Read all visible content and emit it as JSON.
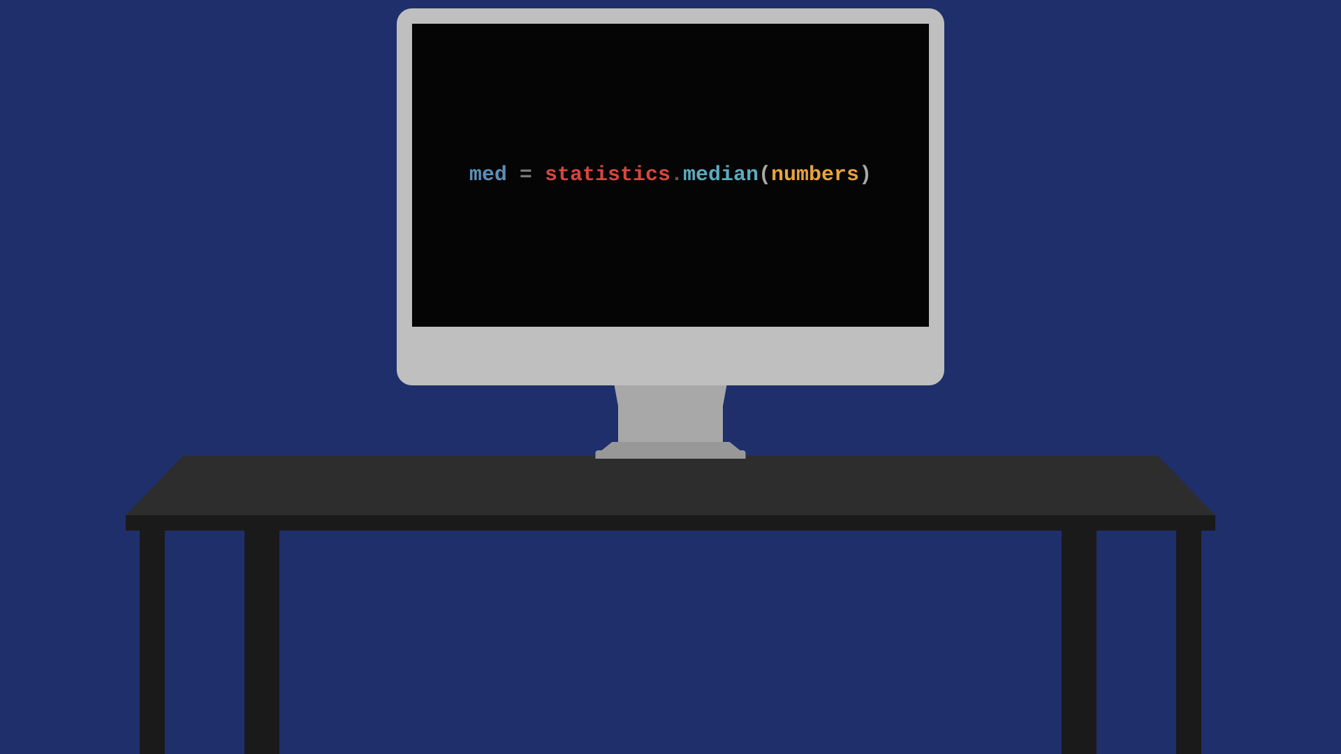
{
  "code": {
    "var": "med",
    "op": " = ",
    "module": "statistics",
    "dot": ".",
    "method": "median",
    "paren_open": "(",
    "arg": "numbers",
    "paren_close": ")"
  },
  "colors": {
    "background": "#1e2f6b",
    "screen": "#050505",
    "bezel": "#bfbfbf",
    "desk": "#2d2d2d",
    "var": "#5b8fb9",
    "op": "#7a7a7a",
    "module": "#d9453d",
    "method": "#5cabbf",
    "paren": "#a8a8a8",
    "arg": "#e8a33d"
  }
}
